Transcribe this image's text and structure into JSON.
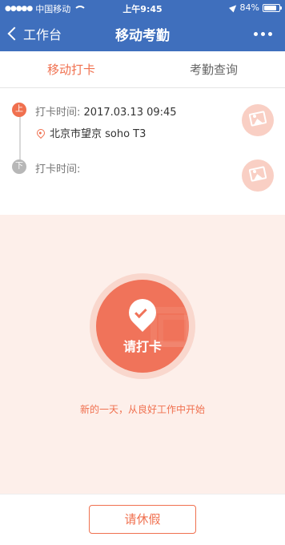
{
  "status_bar": {
    "signal": "●●●●●",
    "carrier": "中国移动",
    "time": "上午9:45",
    "battery": "84%",
    "battery_level": 0.84
  },
  "nav": {
    "back_label": "工作台",
    "title": "移动考勤"
  },
  "tabs": [
    {
      "label": "移动打卡",
      "active": true
    },
    {
      "label": "考勤查询",
      "active": false
    }
  ],
  "records": {
    "on": {
      "badge": "上",
      "time_label": "打卡时间:",
      "time_value": "2017.03.13   09:45",
      "location": "北京市望京 soho T3"
    },
    "off": {
      "badge": "下",
      "time_label": "打卡时间:",
      "time_value": ""
    }
  },
  "clock_in": {
    "label": "请打卡",
    "slogan": "新的一天，从良好工作中开始"
  },
  "bottom": {
    "leave_label": "请休假"
  },
  "colors": {
    "nav_bg": "#3f6fbd",
    "accent": "#f0704f",
    "panel_bg": "#fdefea"
  }
}
